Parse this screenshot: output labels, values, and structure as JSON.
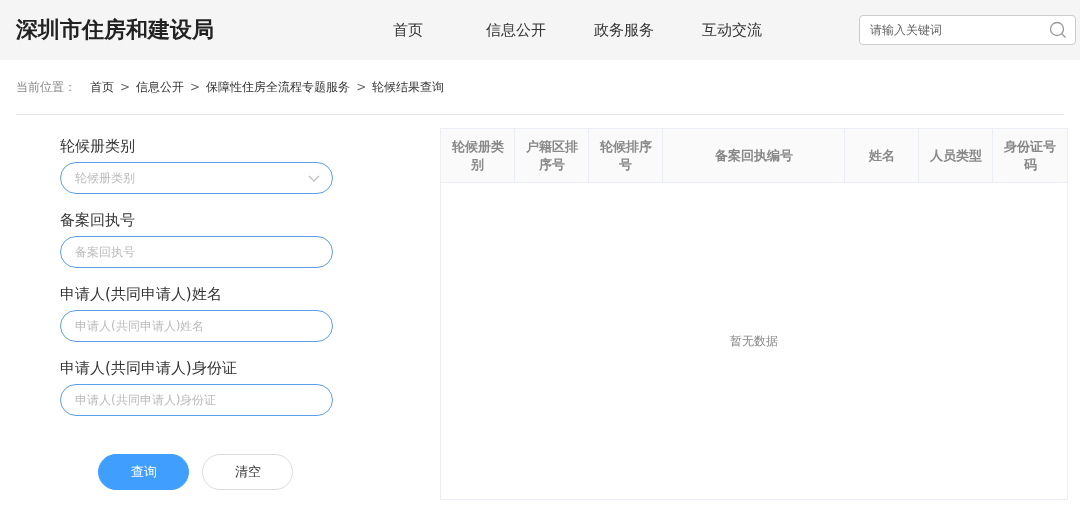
{
  "header": {
    "site_title": "深圳市住房和建设局",
    "nav": [
      {
        "label": "首页"
      },
      {
        "label": "信息公开"
      },
      {
        "label": "政务服务"
      },
      {
        "label": "互动交流"
      }
    ],
    "search": {
      "placeholder": "请输入关键词"
    }
  },
  "breadcrumb": {
    "prefix": "当前位置：",
    "items": [
      {
        "kind": "link",
        "text": "首页"
      },
      {
        "kind": "separator",
        "text": ">"
      },
      {
        "kind": "link",
        "text": "信息公开"
      },
      {
        "kind": "separator",
        "text": ">"
      },
      {
        "kind": "link",
        "text": "保障性住房全流程专题服务"
      },
      {
        "kind": "separator",
        "text": ">"
      },
      {
        "kind": "link",
        "text": "轮候结果查询"
      }
    ]
  },
  "form": {
    "fields": [
      {
        "kind": "select",
        "label": "轮候册类别",
        "placeholder": "轮候册类别"
      },
      {
        "kind": "input",
        "label": "备案回执号",
        "placeholder": "备案回执号"
      },
      {
        "kind": "input",
        "label": "申请人(共同申请人)姓名",
        "placeholder": "申请人(共同申请人)姓名"
      },
      {
        "kind": "input",
        "label": "申请人(共同申请人)身份证",
        "placeholder": "申请人(共同申请人)身份证"
      }
    ],
    "buttons": [
      {
        "kind": "primary",
        "label": "查询"
      },
      {
        "kind": "default",
        "label": "清空"
      }
    ]
  },
  "table": {
    "columns": [
      {
        "label": "轮候册类别",
        "wide": false
      },
      {
        "label": "户籍区排序号",
        "wide": false
      },
      {
        "label": "轮候排序号",
        "wide": false
      },
      {
        "label": "备案回执编号",
        "wide": true
      },
      {
        "label": "姓名",
        "wide": false
      },
      {
        "label": "人员类型",
        "wide": false
      },
      {
        "label": "身份证号码",
        "wide": false
      }
    ],
    "empty_text": "暂无数据"
  }
}
